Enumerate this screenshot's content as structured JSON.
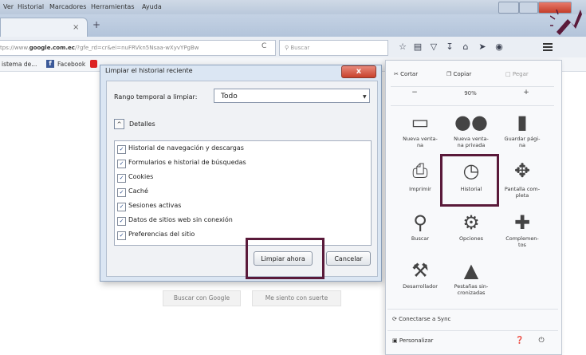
{
  "menubar": {
    "items": [
      "Ver",
      "Historial",
      "Marcadores",
      "Herramientas",
      "Ayuda"
    ]
  },
  "tab": {
    "close": "×",
    "new": "+"
  },
  "navbar": {
    "url_prefix": "tps://www.",
    "url_domain": "google.com.ec",
    "url_rest": "/?gfe_rd=cr&ei=nuFRVkn5Nsaa-wXyvYPgBw",
    "reload": "C",
    "search_placeholder": "Buscar"
  },
  "bookmarks": {
    "item1": "istema de...",
    "item2": "Facebook"
  },
  "dialog": {
    "title": "Limpiar el historial reciente",
    "close": "x",
    "range_label": "Rango temporal a limpiar:",
    "range_value": "Todo",
    "details_toggle": "^",
    "details_label": "Detalles",
    "items": [
      "Historial de navegación y descargas",
      "Formularios e historial de búsquedas",
      "Cookies",
      "Caché",
      "Sesiones activas",
      "Datos de sitios web sin conexión",
      "Preferencias del sitio"
    ],
    "check_mark": "✓",
    "clear_button": "Limpiar ahora",
    "cancel_button": "Cancelar"
  },
  "page": {
    "btn1": "Buscar con Google",
    "btn2": "Me siento con suerte"
  },
  "panel": {
    "cut": "Cortar",
    "copy": "Copiar",
    "paste": "Pegar",
    "zoom_out": "−",
    "zoom": "90%",
    "zoom_in": "+",
    "tiles": [
      {
        "label": "Nueva venta-\nna",
        "icon": "window-icon"
      },
      {
        "label": "Nueva venta-\nna privada",
        "icon": "mask-icon"
      },
      {
        "label": "Guardar pági-\nna",
        "icon": "save-page-icon"
      },
      {
        "label": "Imprimir",
        "icon": "print-icon"
      },
      {
        "label": "Historial",
        "icon": "clock-icon"
      },
      {
        "label": "Pantalla com-\npleta",
        "icon": "fullscreen-icon"
      },
      {
        "label": "Buscar",
        "icon": "search-icon"
      },
      {
        "label": "Opciones",
        "icon": "gear-icon"
      },
      {
        "label": "Complemen-\ntos",
        "icon": "puzzle-icon"
      },
      {
        "label": "Desarrollador",
        "icon": "wrench-icon"
      },
      {
        "label": "Pestañas sin-\ncronizadas",
        "icon": "tabs-sync-icon"
      }
    ],
    "sync": "Conectarse a Sync",
    "customize": "Personalizar"
  },
  "colors": {
    "highlight": "#5a1a3a",
    "arrow": "#5a1a3a"
  }
}
